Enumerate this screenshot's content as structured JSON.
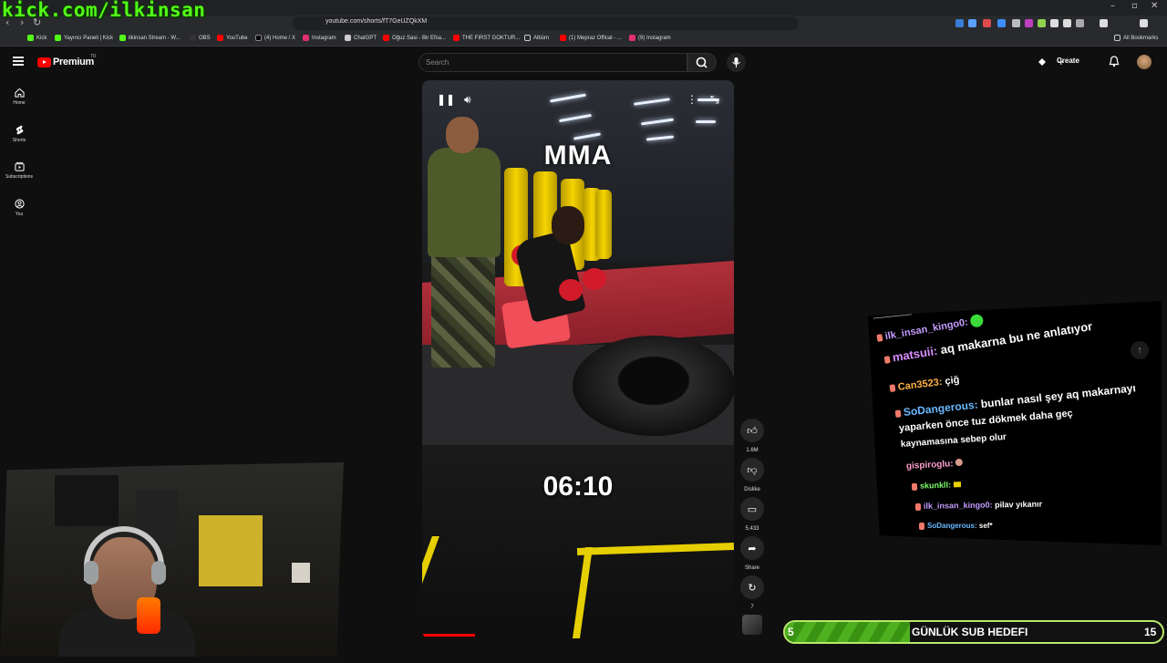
{
  "overlay": {
    "kick_url": "kick.com/ilkinsan"
  },
  "browser": {
    "url": "youtube.com/shorts/fT7GeUZQkXM",
    "bookmarks": [
      "Kick",
      "Yayıncı Paneli | Kick",
      "ilkinsan Stream - W...",
      "OBS",
      "YouTube",
      "(4) Home / X",
      "Instagram",
      "ChatGPT",
      "Oğuz Sasi - Bir Efsa...",
      "THE FIRST GOKTUR...",
      "Albüm",
      "(1) Mepraz Offical - ...",
      "(9) Instagram"
    ],
    "all_bookmarks": "All Bookmarks",
    "window_controls": [
      "–",
      "▫",
      "✕"
    ]
  },
  "youtube": {
    "brand": "Premium",
    "country": "TR",
    "search_placeholder": "Search",
    "create_label": "Create",
    "sidebar": [
      {
        "label": "Home",
        "icon": "home-icon"
      },
      {
        "label": "Shorts",
        "icon": "shorts-icon"
      },
      {
        "label": "Subscriptions",
        "icon": "subscriptions-icon"
      },
      {
        "label": "You",
        "icon": "you-icon"
      }
    ],
    "video": {
      "caption_top": "MMA",
      "caption_timer": "06:10",
      "progress": 0.17
    },
    "actions": [
      {
        "label": "1.6M",
        "icon": "like-icon"
      },
      {
        "label": "Dislike",
        "icon": "dislike-icon"
      },
      {
        "label": "5,433",
        "icon": "comment-icon"
      },
      {
        "label": "Share",
        "icon": "share-icon"
      },
      {
        "label": "7",
        "icon": "remix-icon"
      }
    ]
  },
  "chat": {
    "header": "——————",
    "messages": [
      {
        "user": "ilk_insan_kingo0:",
        "text": "",
        "color": "#c59cff"
      },
      {
        "user": "matsuii:",
        "text": "aq makarna bu ne anlatıyor",
        "color": "#d88cff"
      },
      {
        "user": "Can3523:",
        "text": "çiğ",
        "color": "#ffb347"
      },
      {
        "user": "SoDangerous:",
        "text": "bunlar nasıl şey aq makarnayı",
        "color": "#6ab8ff"
      },
      {
        "user": "",
        "text": "yaparken önce tuz dökmek daha geç",
        "color": "#fff"
      },
      {
        "user": "",
        "text": "kaynamasına sebep olur",
        "color": "#fff"
      },
      {
        "user": "gispiroglu:",
        "text": "",
        "color": "#ff9ecf"
      },
      {
        "user": "skunkll:",
        "text": "",
        "color": "#7cff6a"
      },
      {
        "user": "ilk_insan_kingo0:",
        "text": "pilav yıkanır",
        "color": "#c59cff"
      },
      {
        "user": "SoDangerous:",
        "text": "sef*",
        "color": "#6ab8ff"
      }
    ]
  },
  "sub_goal": {
    "current": "5",
    "title": "GÜNLÜK SUB HEDEFI",
    "target": "15",
    "fill": 0.33
  },
  "colors": {
    "kick_green": "#53fc18",
    "yt_red": "#ff0000",
    "goal_green": "#4fb01f"
  }
}
